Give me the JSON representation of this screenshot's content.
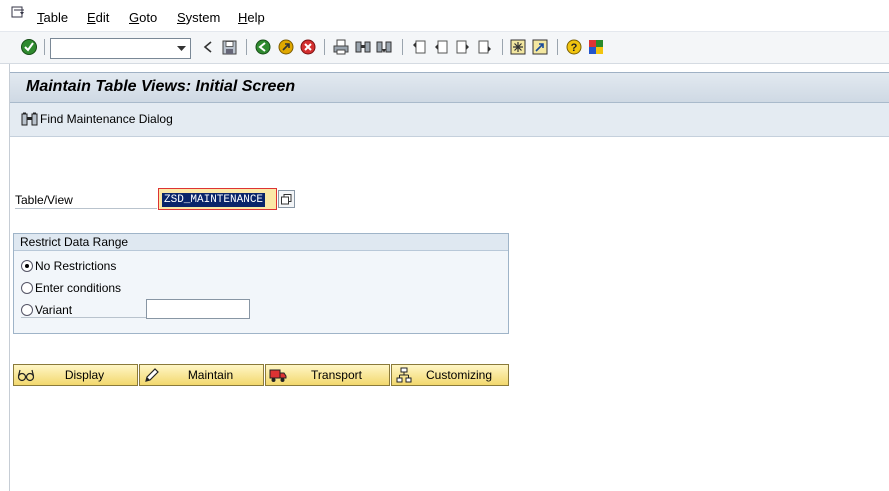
{
  "menu": {
    "items": [
      {
        "label": "Table",
        "mnemonic": "T"
      },
      {
        "label": "Edit",
        "mnemonic": "E"
      },
      {
        "label": "Goto",
        "mnemonic": "G"
      },
      {
        "label": "System",
        "mnemonic": "S"
      },
      {
        "label": "Help",
        "mnemonic": "H"
      }
    ]
  },
  "toolbar": {
    "command_field_value": "",
    "icons": [
      "enter-icon",
      "back-arrow-icon",
      "save-icon",
      "back-icon",
      "exit-icon",
      "cancel-icon",
      "print-icon",
      "find-icon",
      "find-next-icon",
      "first-page-icon",
      "previous-page-icon",
      "next-page-icon",
      "last-page-icon",
      "create-session-icon",
      "shortcut-icon",
      "help-icon",
      "customize-layout-icon"
    ]
  },
  "screen": {
    "title": "Maintain Table Views: Initial Screen"
  },
  "app_toolbar": {
    "find_label": "Find Maintenance Dialog"
  },
  "form": {
    "table_view_label": "Table/View",
    "table_view_value": "ZSD_MAINTENANCE",
    "group_title": "Restrict Data Range",
    "options": [
      {
        "label": "No Restrictions",
        "checked": true
      },
      {
        "label": "Enter conditions",
        "checked": false
      },
      {
        "label": "Variant",
        "checked": false
      }
    ],
    "variant_value": ""
  },
  "buttons": {
    "display": "Display",
    "maintain": "Maintain",
    "transport": "Transport",
    "customizing": "Customizing"
  },
  "colors": {
    "title_bg": "#cfd9e4",
    "button_bg": "#f2d86e",
    "input_required_bg": "#fbe8a6",
    "selection_bg": "#0a246a"
  }
}
